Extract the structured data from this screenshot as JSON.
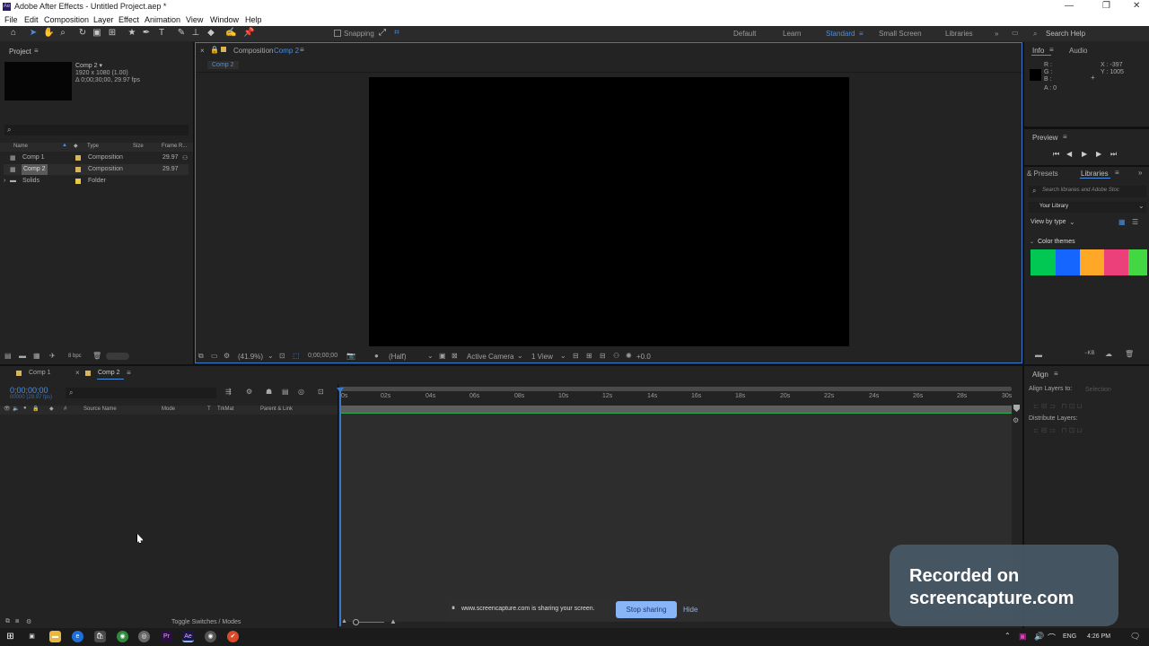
{
  "window": {
    "title": "Adobe After Effects - Untitled Project.aep *",
    "app_icon": "Ae"
  },
  "menu": [
    "File",
    "Edit",
    "Composition",
    "Layer",
    "Effect",
    "Animation",
    "View",
    "Window",
    "Help"
  ],
  "toolbar": {
    "snapping": "Snapping",
    "workspaces": [
      "Default",
      "Learn",
      "Standard",
      "Small Screen",
      "Libraries"
    ],
    "active_workspace": "Standard",
    "search_placeholder": "Search Help"
  },
  "project": {
    "title": "Project",
    "comp_name": "Comp 2 ▾",
    "comp_info1": "1920 x 1080 (1.00)",
    "comp_info2": "Δ 0;00;30;00, 29.97 fps",
    "columns": [
      "Name",
      "Type",
      "Size",
      "Frame R..."
    ],
    "items": [
      {
        "name": "Comp 1",
        "type": "Composition",
        "rate": "29.97"
      },
      {
        "name": "Comp 2",
        "type": "Composition",
        "rate": "29.97"
      },
      {
        "name": "Solids",
        "type": "Folder",
        "rate": ""
      }
    ],
    "bpc": "8 bpc"
  },
  "composition": {
    "tab_prefix": "Composition",
    "tab_name": "Comp 2",
    "breadcrumb": "Comp 2",
    "zoom": "(41.9%)",
    "timecode": "0;00;00;00",
    "resolution": "(Half)",
    "camera": "Active Camera",
    "views": "1 View",
    "exposure": "+0.0"
  },
  "info": {
    "tabs": [
      "Info",
      "Audio"
    ],
    "r": "R :",
    "g": "G :",
    "b": "B :",
    "a": "A : 0",
    "x": "X : -397",
    "y": "Y : 1005"
  },
  "preview": {
    "title": "Preview"
  },
  "libraries": {
    "tabs": [
      "& Presets",
      "Libraries"
    ],
    "search": "Search libraries and Adobe Stoc",
    "library": "Your Library",
    "view_by": "View by type",
    "color_themes": "Color themes",
    "colors": [
      "#00c853",
      "#1565ff",
      "#ffa726",
      "#ec407a",
      "#43d843"
    ]
  },
  "timeline": {
    "tabs": [
      "Comp 1",
      "Comp 2"
    ],
    "timecode": "0;00;00;00",
    "fps": "00000 (29.97 fps)",
    "columns": [
      "Source Name",
      "Mode",
      "T",
      "TrkMat",
      "Parent & Link"
    ],
    "ticks": [
      "0s",
      "02s",
      "04s",
      "06s",
      "08s",
      "10s",
      "12s",
      "14s",
      "16s",
      "18s",
      "20s",
      "22s",
      "24s",
      "26s",
      "28s",
      "30s"
    ],
    "toggle": "Toggle Switches / Modes"
  },
  "align": {
    "title": "Align",
    "align_to_label": "Align Layers to:",
    "align_to_value": "Selection",
    "distribute": "Distribute Layers:"
  },
  "sharing": {
    "message": "www.screencapture.com is sharing your screen.",
    "stop": "Stop sharing",
    "hide": "Hide"
  },
  "watermark": {
    "line1": "Recorded on",
    "line2": "screencapture.com"
  },
  "taskbar": {
    "lang": "ENG",
    "time": "4:26 PM"
  }
}
